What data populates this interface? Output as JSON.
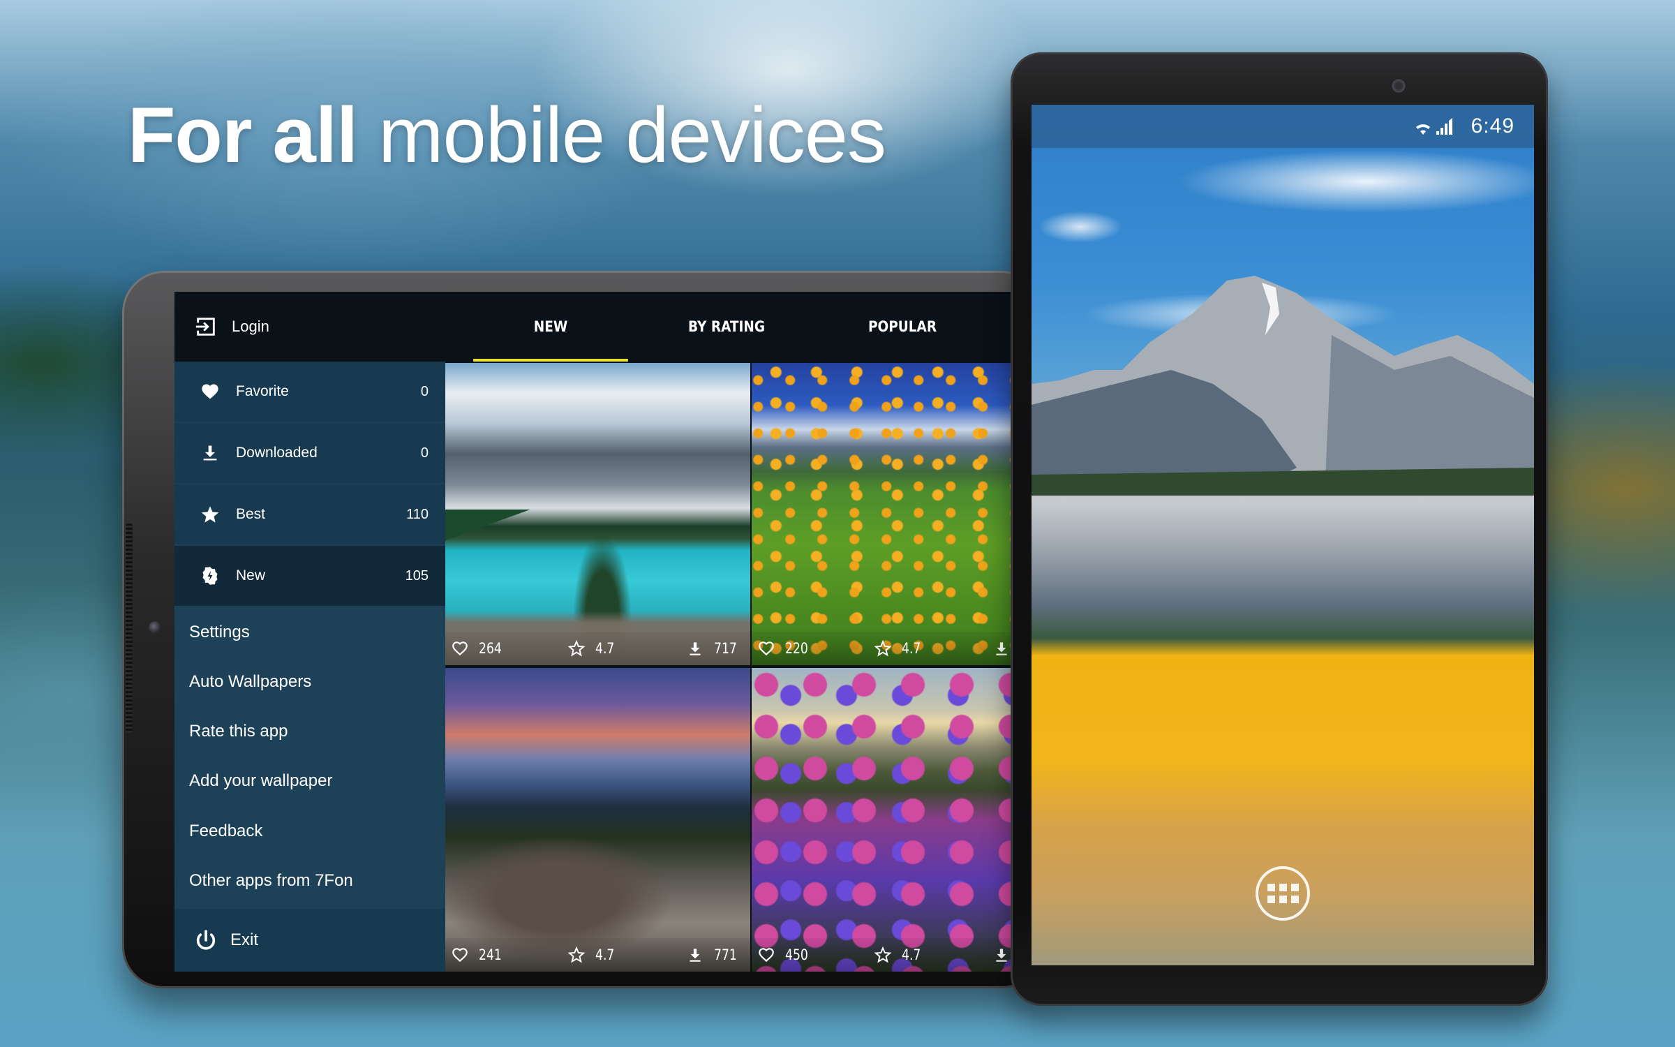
{
  "headline": {
    "bold_part": "For all",
    "light_part": " mobile devices"
  },
  "tablet_app": {
    "header": {
      "login_label": "Login",
      "login_icon": "login-icon",
      "tabs": [
        {
          "label": "NEW",
          "active": true
        },
        {
          "label": "BY RATING",
          "active": false
        },
        {
          "label": "POPULAR",
          "active": false
        }
      ],
      "active_tab_indicator_color": "#e8e336"
    },
    "sidebar": {
      "categories": [
        {
          "label": "Favorite",
          "count": "0",
          "icon": "heart-icon",
          "active": false
        },
        {
          "label": "Downloaded",
          "count": "0",
          "icon": "download-icon",
          "active": false
        },
        {
          "label": "Best",
          "count": "110",
          "icon": "star-icon",
          "active": false
        },
        {
          "label": "New",
          "count": "105",
          "icon": "new-badge-icon",
          "active": true
        }
      ],
      "links": [
        {
          "label": "Settings"
        },
        {
          "label": "Auto Wallpapers"
        },
        {
          "label": "Rate this app"
        },
        {
          "label": "Add your wallpaper"
        },
        {
          "label": "Feedback"
        },
        {
          "label": "Other apps from 7Fon"
        }
      ],
      "exit_label": "Exit",
      "exit_icon": "power-icon"
    },
    "wallpapers": [
      {
        "subject": "mountain lake",
        "likes": "264",
        "rating": "4.7",
        "downloads": "717"
      },
      {
        "subject": "flower meadow",
        "likes": "220",
        "rating": "4.7",
        "downloads": ""
      },
      {
        "subject": "sunset over rocks",
        "likes": "241",
        "rating": "4.7",
        "downloads": "771"
      },
      {
        "subject": "hydrangea field",
        "likes": "450",
        "rating": "4.7",
        "downloads": ""
      }
    ],
    "colors": {
      "sidebar_bg": "#1d4257",
      "header_bg": "#0a1117",
      "active_item_bg": "#12293a"
    }
  },
  "phone": {
    "status_bar": {
      "time": "6:49",
      "icons": [
        "wifi-icon",
        "signal-icon"
      ]
    },
    "wallpaper_subject": "mountain with autumn aspens",
    "home_button_icon": "app-drawer-icon"
  }
}
